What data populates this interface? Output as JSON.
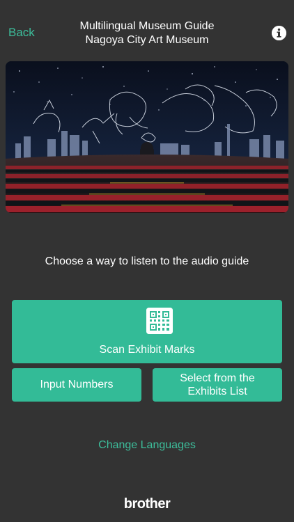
{
  "nav": {
    "back_label": "Back",
    "title_line1": "Multilingual Museum Guide",
    "title_line2": "Nagoya City Art Museum",
    "info_icon": "info-icon"
  },
  "hero": {
    "image": "planetarium-dome-photo"
  },
  "main": {
    "prompt": "Choose a way to listen to the audio guide",
    "scan_label": "Scan Exhibit Marks",
    "scan_icon": "qr-code-icon",
    "input_numbers_label": "Input Numbers",
    "exhibits_list_label": "Select from the Exhibits List",
    "change_languages_label": "Change Languages"
  },
  "footer": {
    "brand": "brother"
  },
  "colors": {
    "background": "#333333",
    "accent": "#33bb97",
    "link": "#3dbf9c",
    "text": "#ffffff"
  }
}
